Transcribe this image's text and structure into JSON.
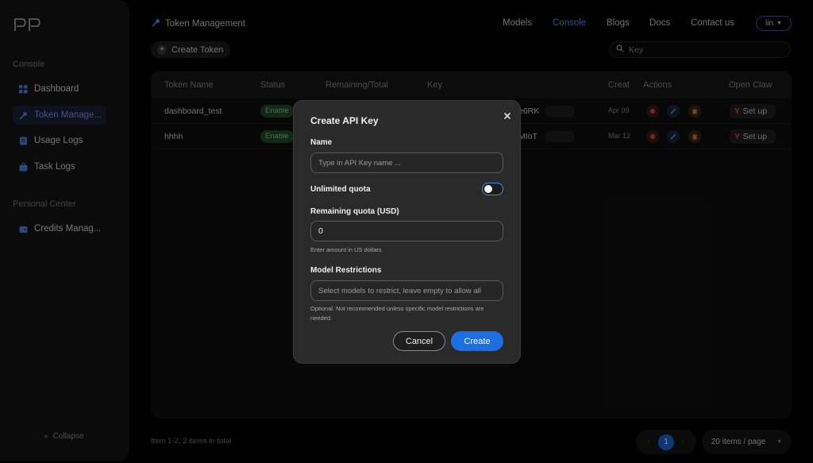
{
  "app": {
    "brand_icon": "pp-logo-icon"
  },
  "sidebar": {
    "section_console": "Console",
    "items_console": [
      {
        "label": "Dashboard",
        "icon": "grid-icon"
      },
      {
        "label": "Token Manage...",
        "icon": "key-icon",
        "active": true
      },
      {
        "label": "Usage Logs",
        "icon": "document-icon"
      },
      {
        "label": "Task Logs",
        "icon": "briefcase-icon"
      }
    ],
    "section_personal": "Personal Center",
    "items_personal": [
      {
        "label": "Credits Manag...",
        "icon": "wallet-icon"
      }
    ],
    "collapse_label": "Collapse"
  },
  "header": {
    "title": "Token Management",
    "nav": [
      "Models",
      "Console",
      "Blogs",
      "Docs",
      "Contact us"
    ],
    "active_nav": "Console",
    "user": "lin"
  },
  "toolbar": {
    "create_label": "Create Token",
    "search_placeholder": "Key"
  },
  "table": {
    "columns": [
      "Token Name",
      "Status",
      "Remaining/Total",
      "Key",
      "Creat",
      "Actions",
      "Open Claw"
    ],
    "rows": [
      {
        "name": "dashboard_test",
        "status": "Enable",
        "key_tail": "e6RK",
        "created": "Apr 09",
        "setup": "Set up"
      },
      {
        "name": "hhhh",
        "status": "Enable",
        "key_tail": "MIoT",
        "created": "Mar 12",
        "setup": "Set up"
      }
    ]
  },
  "footer": {
    "summary": "Item 1-2, 2 items in total",
    "current_page": "1",
    "page_size": "20 items / page"
  },
  "modal": {
    "title": "Create API Key",
    "name_label": "Name",
    "name_placeholder": "Type in API Key name ...",
    "unlimited_label": "Unlimited quota",
    "unlimited_on": false,
    "quota_label": "Remaining quota (USD)",
    "quota_value": "0",
    "quota_help": "Enter amount in US dollars",
    "models_label": "Model Restrictions",
    "models_placeholder": "Select models to restrict, leave empty to allow all",
    "models_help": "Optional. Not recommended unless specific model restrictions are needed.",
    "cancel_label": "Cancel",
    "create_label": "Create"
  },
  "colors": {
    "accent": "#1d6ee0",
    "enabled_bg": "#1f4a2a",
    "enabled_text": "#7ccf8a"
  }
}
